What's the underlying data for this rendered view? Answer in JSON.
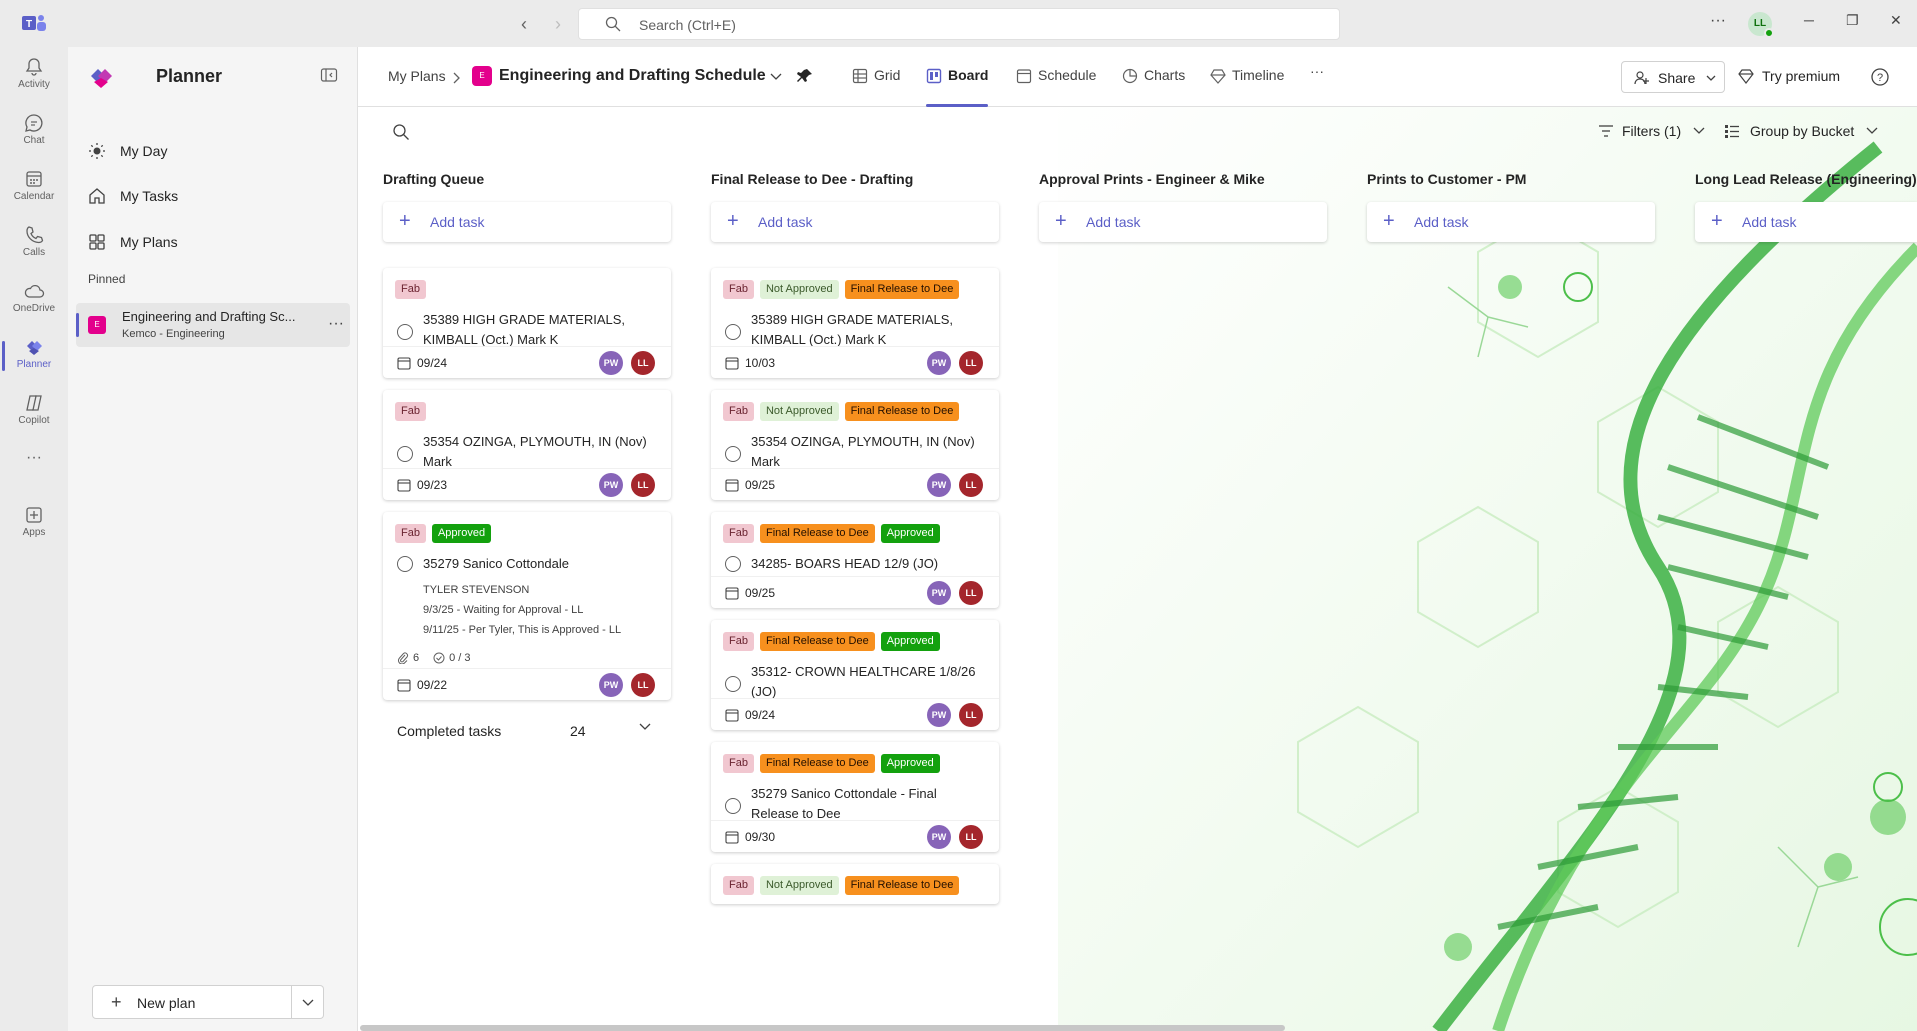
{
  "titlebar": {
    "search_placeholder": "Search (Ctrl+E)",
    "more_label": "···",
    "user_initials": "LL",
    "minimize": "─",
    "restore": "❐",
    "close": "✕"
  },
  "apprail": {
    "items": [
      {
        "label": "Activity",
        "icon": "bell-icon"
      },
      {
        "label": "Chat",
        "icon": "chat-icon"
      },
      {
        "label": "Calendar",
        "icon": "calendar-icon"
      },
      {
        "label": "Calls",
        "icon": "phone-icon"
      },
      {
        "label": "OneDrive",
        "icon": "cloud-icon"
      },
      {
        "label": "Planner",
        "icon": "planner-icon",
        "active": true
      },
      {
        "label": "Copilot",
        "icon": "copilot-icon"
      },
      {
        "label": "···",
        "icon": "more-icon"
      },
      {
        "label": "Apps",
        "icon": "apps-icon"
      }
    ]
  },
  "sidebar": {
    "title": "Planner",
    "nav": [
      {
        "label": "My Day",
        "icon": "sun-icon"
      },
      {
        "label": "My Tasks",
        "icon": "home-icon"
      },
      {
        "label": "My Plans",
        "icon": "grid-icon"
      }
    ],
    "pinned_label": "Pinned",
    "pinned": {
      "icon_text": "E",
      "title": "Engineering and Drafting Sc...",
      "subtitle": "Kemco - Engineering",
      "more": "···"
    },
    "new_plan_label": "New plan"
  },
  "header": {
    "breadcrumb_root": "My Plans",
    "plan_icon_text": "E",
    "plan_title": "Engineering and Drafting Schedule",
    "tabs": [
      {
        "label": "Grid",
        "icon": "grid-icon"
      },
      {
        "label": "Board",
        "icon": "board-icon",
        "active": true
      },
      {
        "label": "Schedule",
        "icon": "calendar-icon"
      },
      {
        "label": "Charts",
        "icon": "charts-icon"
      },
      {
        "label": "Timeline",
        "icon": "timeline-icon"
      }
    ],
    "more_tabs": "···",
    "share_label": "Share",
    "premium_label": "Try premium"
  },
  "toolbar": {
    "filters_label": "Filters (1)",
    "group_label": "Group by Bucket"
  },
  "colors": {
    "accent": "#5b5fc7",
    "fab": "#f1c7d0",
    "not_approved": "#dff1d7",
    "final_release": "#f7901e",
    "approved": "#13a10e",
    "plan_icon": "#e3008c"
  },
  "add_task_label": "Add task",
  "buckets": [
    {
      "title": "Drafting Queue",
      "cards": [
        {
          "labels": [
            "Fab"
          ],
          "title": "35389 HIGH GRADE MATERIALS, KIMBALL (Oct.) Mark K",
          "due": "09/24",
          "avatars": [
            "PW",
            "LL"
          ]
        },
        {
          "labels": [
            "Fab"
          ],
          "title": "35354 OZINGA, PLYMOUTH, IN (Nov) Mark",
          "due": "09/23",
          "avatars": [
            "PW",
            "LL"
          ]
        },
        {
          "labels": [
            "Fab",
            "Approved"
          ],
          "title": "35279 Sanico Cottondale",
          "notes": [
            "TYLER STEVENSON",
            "9/3/25 - Waiting for Approval - LL",
            "9/11/25 - Per Tyler, This is Approved - LL"
          ],
          "attachments": "6",
          "checklist": "0 / 3",
          "due": "09/22",
          "avatars": [
            "PW",
            "LL"
          ]
        }
      ],
      "completed_label": "Completed tasks",
      "completed_count": "24"
    },
    {
      "title": "Final Release to Dee - Drafting",
      "cards": [
        {
          "labels": [
            "Fab",
            "Not Approved",
            "Final Release to Dee"
          ],
          "title": "35389 HIGH GRADE MATERIALS, KIMBALL (Oct.) Mark K",
          "due": "10/03",
          "avatars": [
            "PW",
            "LL"
          ]
        },
        {
          "labels": [
            "Fab",
            "Not Approved",
            "Final Release to Dee"
          ],
          "title": "35354 OZINGA, PLYMOUTH, IN (Nov) Mark",
          "due": "09/25",
          "avatars": [
            "PW",
            "LL"
          ]
        },
        {
          "labels": [
            "Fab",
            "Final Release to Dee",
            "Approved"
          ],
          "title": "34285- BOARS HEAD 12/9 (JO)",
          "due": "09/25",
          "avatars": [
            "PW",
            "LL"
          ]
        },
        {
          "labels": [
            "Fab",
            "Final Release to Dee",
            "Approved"
          ],
          "title": "35312- CROWN HEALTHCARE 1/8/26 (JO)",
          "due": "09/24",
          "avatars": [
            "PW",
            "LL"
          ]
        },
        {
          "labels": [
            "Fab",
            "Final Release to Dee",
            "Approved"
          ],
          "title": "35279 Sanico Cottondale - Final Release to Dee",
          "due": "09/30",
          "avatars": [
            "PW",
            "LL"
          ]
        },
        {
          "labels": [
            "Fab",
            "Not Approved",
            "Final Release to Dee"
          ]
        }
      ]
    },
    {
      "title": "Approval Prints - Engineer & Mike",
      "cards": []
    },
    {
      "title": "Prints to Customer - PM",
      "cards": []
    },
    {
      "title": "Long Lead Release (Engineering)",
      "cards": []
    }
  ]
}
